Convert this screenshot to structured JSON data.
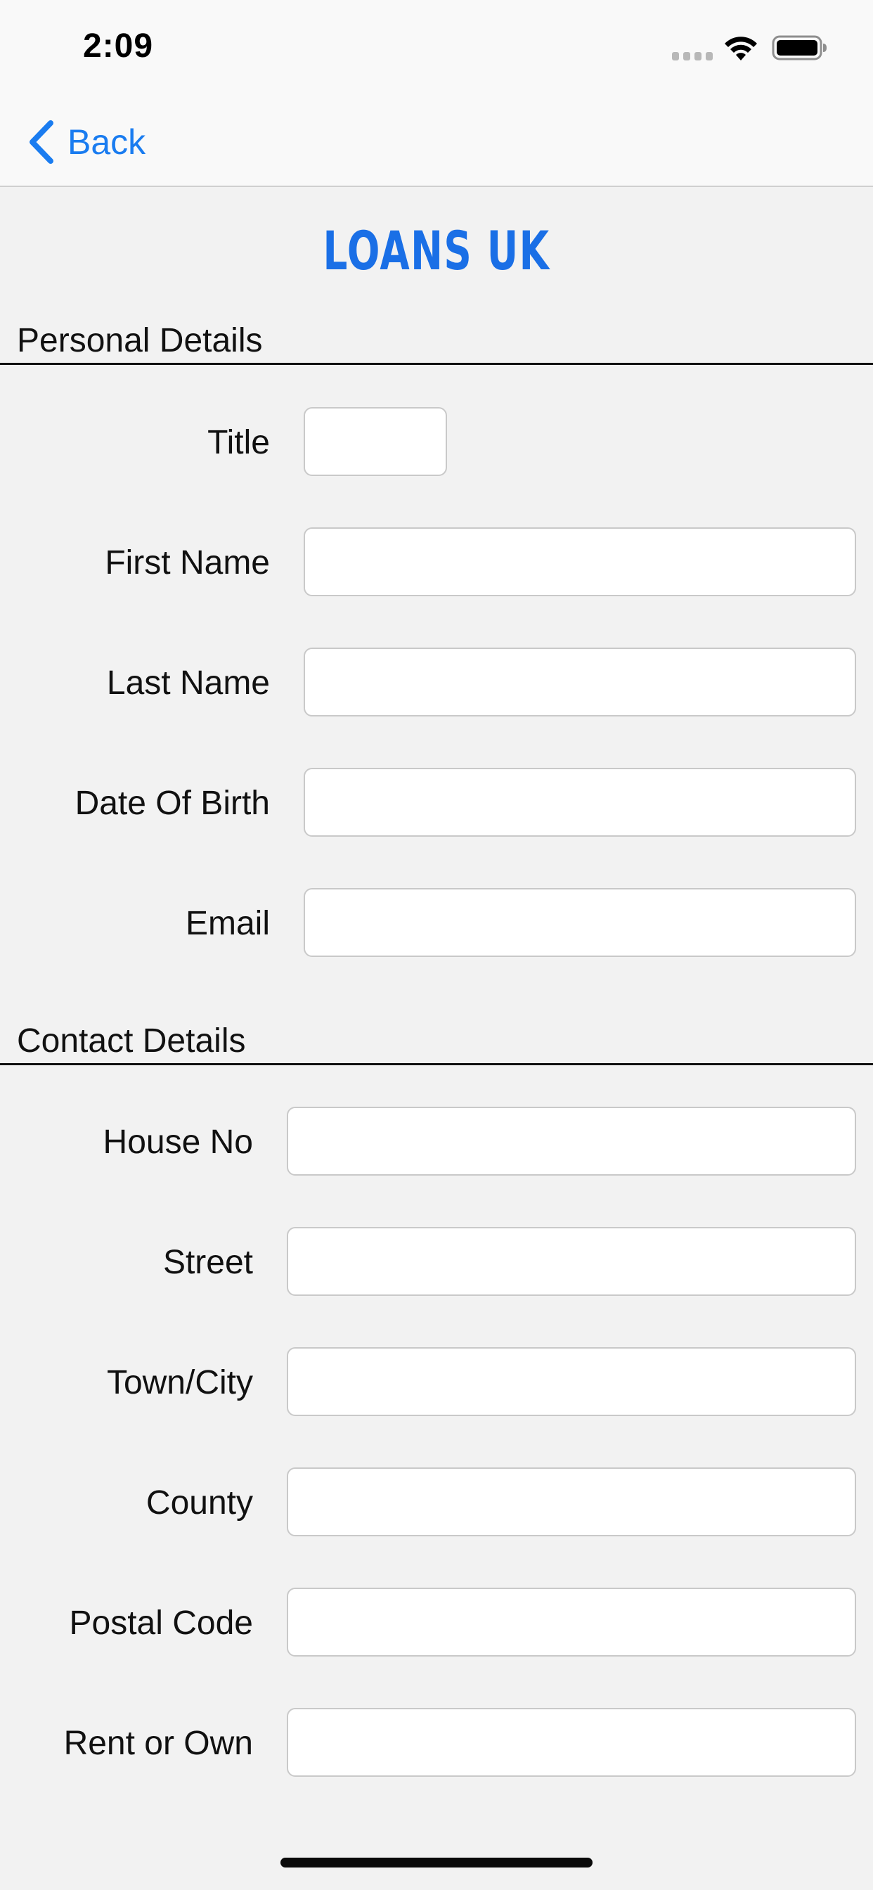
{
  "status_bar": {
    "time": "2:09"
  },
  "nav": {
    "back_label": "Back"
  },
  "logo": {
    "text": "LOANS UK"
  },
  "personal_details": {
    "title": "Personal Details",
    "fields": {
      "title": {
        "label": "Title",
        "value": ""
      },
      "first_name": {
        "label": "First Name",
        "value": ""
      },
      "last_name": {
        "label": "Last Name",
        "value": ""
      },
      "date_of_birth": {
        "label": "Date Of Birth",
        "value": ""
      },
      "email": {
        "label": "Email",
        "value": ""
      }
    }
  },
  "contact_details": {
    "title": "Contact Details",
    "fields": {
      "house_no": {
        "label": "House No",
        "value": ""
      },
      "street": {
        "label": "Street",
        "value": ""
      },
      "town_city": {
        "label": "Town/City",
        "value": ""
      },
      "county": {
        "label": "County",
        "value": ""
      },
      "postal_code": {
        "label": "Postal Code",
        "value": ""
      },
      "rent_or_own": {
        "label": "Rent or Own",
        "value": ""
      }
    }
  },
  "colors": {
    "accent": "#1a7cf0",
    "logo": "#1a6fe6",
    "background": "#f2f2f2"
  }
}
